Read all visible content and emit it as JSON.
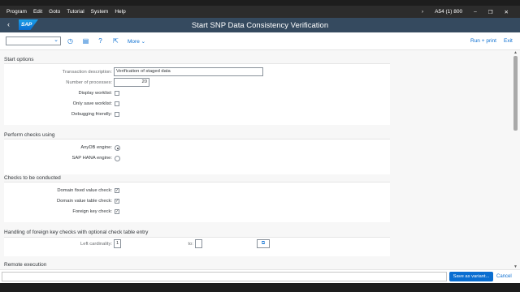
{
  "menubar": {
    "items": [
      "Program",
      "Edit",
      "Goto",
      "Tutorial",
      "System",
      "Help"
    ],
    "system_info": "A54 (1) 800"
  },
  "shell": {
    "logo": "SAP",
    "title": "Start SNP Data Consistency Verification"
  },
  "toolbar": {
    "variant_value": "",
    "more_label": "More",
    "run_print_label": "Run + print",
    "exit_label": "Exit"
  },
  "start_options": {
    "title": "Start options",
    "transaction_description_label": "Transaction description:",
    "transaction_description_value": "Verification of staged data",
    "number_of_processes_label": "Number of processes:",
    "number_of_processes_value": "20",
    "display_worklist_label": "Display worklist:",
    "only_save_worklist_label": "Only save worklist:",
    "debugging_friendly_label": "Debugging friendly:"
  },
  "perform_checks": {
    "title": "Perform checks using",
    "anydb_label": "AnyDB engine:",
    "hana_label": "SAP HANA engine:",
    "selected": "anydb"
  },
  "checks": {
    "title": "Checks to be conducted",
    "domain_fixed_label": "Domain fixed value check:",
    "domain_fixed_checked": true,
    "domain_table_label": "Domain value table check:",
    "domain_table_checked": true,
    "foreign_key_label": "Foreign key check:",
    "foreign_key_checked": true
  },
  "foreign_keys": {
    "title": "Handling of foreign key checks with optional check table entry",
    "left_cardinality_label": "Left cardinality:",
    "left_cardinality_value": "1",
    "to_label": "to:",
    "to_value": ""
  },
  "remote": {
    "title": "Remote execution"
  },
  "footer": {
    "save_variant_label": "Save as variant...",
    "cancel_label": "Cancel"
  }
}
